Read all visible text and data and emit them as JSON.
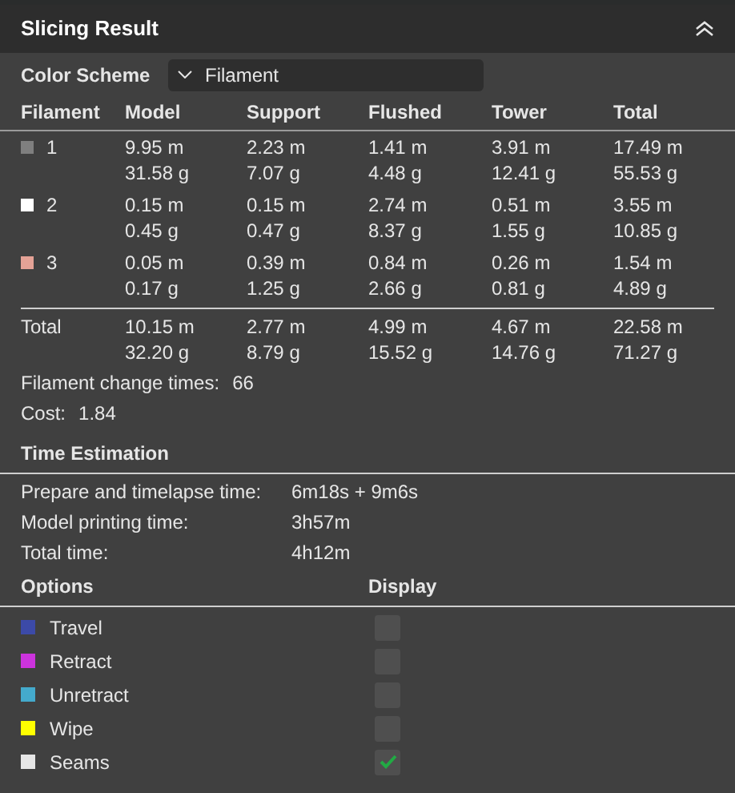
{
  "header": {
    "title": "Slicing Result"
  },
  "color_scheme": {
    "label": "Color Scheme",
    "value": "Filament"
  },
  "table": {
    "columns": [
      "Filament",
      "Model",
      "Support",
      "Flushed",
      "Tower",
      "Total"
    ],
    "rows": [
      {
        "color": "#7f7f7f",
        "cells": [
          "1",
          [
            "9.95 m",
            "31.58 g"
          ],
          [
            "2.23 m",
            "7.07 g"
          ],
          [
            "1.41 m",
            "4.48 g"
          ],
          [
            "3.91 m",
            "12.41 g"
          ],
          [
            "17.49 m",
            "55.53 g"
          ]
        ]
      },
      {
        "color": "#ffffff",
        "cells": [
          "2",
          [
            "0.15 m",
            "0.45 g"
          ],
          [
            "0.15 m",
            "0.47 g"
          ],
          [
            "2.74 m",
            "8.37 g"
          ],
          [
            "0.51 m",
            "1.55 g"
          ],
          [
            "3.55 m",
            "10.85 g"
          ]
        ]
      },
      {
        "color": "#e4a296",
        "cells": [
          "3",
          [
            "0.05 m",
            "0.17 g"
          ],
          [
            "0.39 m",
            "1.25 g"
          ],
          [
            "0.84 m",
            "2.66 g"
          ],
          [
            "0.26 m",
            "0.81 g"
          ],
          [
            "1.54 m",
            "4.89 g"
          ]
        ]
      }
    ],
    "total": {
      "cells": [
        "Total",
        [
          "10.15 m",
          "32.20 g"
        ],
        [
          "2.77 m",
          "8.79 g"
        ],
        [
          "4.99 m",
          "15.52 g"
        ],
        [
          "4.67 m",
          "14.76 g"
        ],
        [
          "22.58 m",
          "71.27 g"
        ]
      ]
    }
  },
  "stats": [
    {
      "label": "Filament change times:",
      "value": "66"
    },
    {
      "label": "Cost:",
      "value": "1.84"
    }
  ],
  "time_estimation": {
    "title": "Time Estimation",
    "rows": [
      {
        "label": "Prepare and timelapse time:",
        "value": "6m18s + 9m6s"
      },
      {
        "label": "Model printing time:",
        "value": "3h57m"
      },
      {
        "label": "Total time:",
        "value": "4h12m"
      }
    ]
  },
  "options": {
    "columns": [
      "Options",
      "Display"
    ],
    "items": [
      {
        "label": "Travel",
        "color": "#3c4aa8",
        "checked": false
      },
      {
        "label": "Retract",
        "color": "#cc33dd",
        "checked": false
      },
      {
        "label": "Unretract",
        "color": "#44aacc",
        "checked": false
      },
      {
        "label": "Wipe",
        "color": "#ffff00",
        "checked": false
      },
      {
        "label": "Seams",
        "color": "#e6e6e6",
        "checked": true
      }
    ]
  }
}
